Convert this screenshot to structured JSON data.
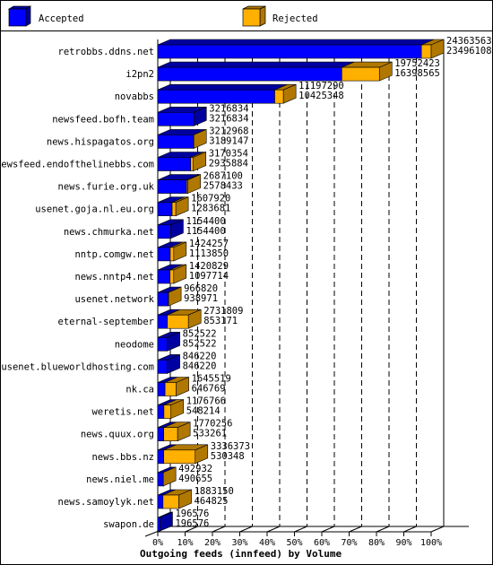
{
  "chart_data": {
    "type": "bar",
    "orientation": "horizontal",
    "style": "3d",
    "title": "Outgoing feeds (innfeed) by Volume",
    "xlabel": "Outgoing feeds (innfeed) by Volume",
    "ylabel": "",
    "xlim": [
      0,
      100
    ],
    "x_unit": "%",
    "x_ticks": [
      "0%",
      "10%",
      "20%",
      "30%",
      "40%",
      "50%",
      "60%",
      "70%",
      "80%",
      "90%",
      "100%"
    ],
    "grid": "vertical dashed",
    "legend": {
      "placement": "top",
      "entries": [
        {
          "name": "Accepted",
          "color": "#0000ff"
        },
        {
          "name": "Rejected",
          "color": "#ffb000"
        }
      ]
    },
    "max_total": 24363563,
    "categories": [
      "retrobbs.ddns.net",
      "i2pn2",
      "novabbs",
      "newsfeed.bofh.team",
      "news.hispagatos.org",
      "newsfeed.endofthelinebbs.com",
      "news.furie.org.uk",
      "usenet.goja.nl.eu.org",
      "news.chmurka.net",
      "nntp.comgw.net",
      "news.nntp4.net",
      "usenet.network",
      "eternal-september",
      "neodome",
      "usenet.blueworldhosting.com",
      "nk.ca",
      "weretis.net",
      "news.quux.org",
      "news.bbs.nz",
      "news.niel.me",
      "news.samoylyk.net",
      "swapon.de"
    ],
    "totals": [
      24363563,
      19752423,
      11197290,
      3216834,
      3212968,
      3170354,
      2687100,
      1607920,
      1154400,
      1424257,
      1420829,
      966820,
      2731809,
      852522,
      846220,
      1645519,
      1176766,
      1770256,
      3336373,
      492932,
      1883150,
      196576
    ],
    "series": [
      {
        "name": "Accepted",
        "color": "#0000ff",
        "values": [
          23496108,
          16398565,
          10425348,
          3216834,
          3189147,
          2935884,
          2578433,
          1283681,
          1154400,
          1113850,
          1097714,
          938971,
          853171,
          852522,
          846220,
          646769,
          548214,
          533261,
          530348,
          490655,
          464825,
          196576
        ]
      },
      {
        "name": "Rejected",
        "color": "#ffb000",
        "values": [
          867455,
          3353858,
          771942,
          0,
          23821,
          234470,
          108667,
          324239,
          0,
          310407,
          323115,
          27849,
          1878638,
          0,
          0,
          998750,
          628552,
          1236995,
          2806025,
          2277,
          1418325,
          0
        ]
      }
    ]
  }
}
